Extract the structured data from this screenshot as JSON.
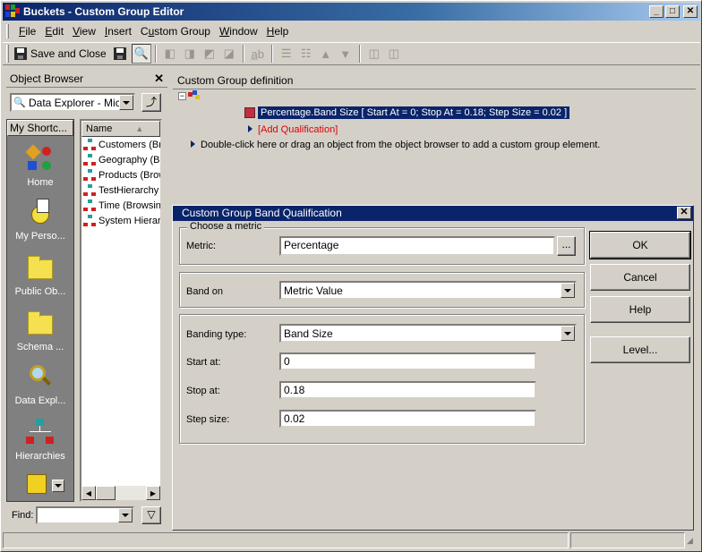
{
  "window": {
    "title": "Buckets - Custom Group Editor"
  },
  "menu": [
    {
      "key": "F",
      "rest": "ile"
    },
    {
      "key": "E",
      "rest": "dit"
    },
    {
      "key": "V",
      "rest": "iew"
    },
    {
      "key": "I",
      "rest": "nsert"
    },
    {
      "key": "",
      "pre": "C",
      "key2": "u",
      "rest": "stom Group"
    },
    {
      "key": "W",
      "rest": "indow"
    },
    {
      "key": "H",
      "rest": "elp"
    }
  ],
  "toolbar": {
    "save_close_label": "Save and Close"
  },
  "object_browser": {
    "title": "Object Browser",
    "source": "Data Explorer - Micro",
    "shortcuts_tab": "My Shortc...",
    "shortcuts": [
      {
        "label": "Home",
        "icon": "home-icon"
      },
      {
        "label": "My Perso...",
        "icon": "my-personal-objects-icon"
      },
      {
        "label": "Public Ob...",
        "icon": "folder-icon"
      },
      {
        "label": "Schema ...",
        "icon": "folder-icon"
      },
      {
        "label": "Data Expl...",
        "icon": "data-explorer-icon"
      },
      {
        "label": "Hierarchies",
        "icon": "hierarchy-icon"
      }
    ],
    "column_name": "Name",
    "items": [
      "Customers (Bro",
      "Geography (Br",
      "Products (Brow",
      "TestHierarchy",
      "Time (Browsing",
      "System Hierarc"
    ],
    "find_label": "Find:",
    "find_value": ""
  },
  "custom_group_definition": {
    "title": "Custom Group definition",
    "element": "Percentage.Band Size [ Start At = 0; Stop At = 0.18; Step Size = 0.02 ]",
    "add_qualification": "[Add Qualification]",
    "hint": "Double-click here or drag an object from the object browser to add a custom group element."
  },
  "dialog": {
    "title": "Custom Group Band Qualification",
    "choose_metric_legend": "Choose a metric",
    "metric_label": "Metric:",
    "metric_value": "Percentage",
    "browse_label": "...",
    "band_on_label": "Band on",
    "band_on_value": "Metric Value",
    "banding_type_label": "Banding type:",
    "banding_type_value": "Band Size",
    "start_at_label": "Start at:",
    "start_at_value": "0",
    "stop_at_label": "Stop at:",
    "stop_at_value": "0.18",
    "step_size_label": "Step size:",
    "step_size_value": "0.02",
    "buttons": {
      "ok": "OK",
      "cancel": "Cancel",
      "help": "Help",
      "level": "Level..."
    }
  },
  "colors": {
    "titlebar": "#0a246a",
    "face": "#d4d0c8",
    "add_qualification": "#e00000"
  }
}
